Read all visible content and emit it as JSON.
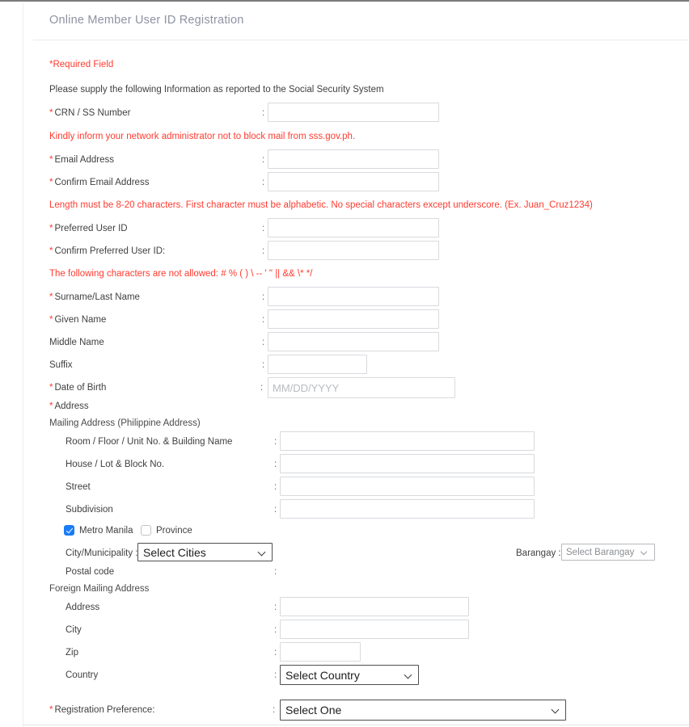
{
  "panel": {
    "title": "Online Member User ID Registration"
  },
  "notices": {
    "required_field": "*Required Field",
    "instruction": "Please supply the following Information as reported to the Social Security System",
    "mail_block": "Kindly inform your network administrator not to block mail from sss.gov.ph.",
    "userid_rule": "Length must be 8-20 characters. First character must be alphabetic. No special characters except underscore. (Ex. Juan_Cruz1234)",
    "disallowed_chars": "The following characters are not allowed: # % ( ) \\ -- ' \" || && \\* */"
  },
  "fields": {
    "crn": {
      "label": "CRN / SS Number",
      "value": "",
      "required": true
    },
    "email": {
      "label": "Email Address",
      "value": "",
      "required": true
    },
    "confirm_email": {
      "label": "Confirm Email Address",
      "value": "",
      "required": true
    },
    "preferred_userid": {
      "label": "Preferred User ID",
      "value": "",
      "required": true
    },
    "confirm_userid": {
      "label": "Confirm Preferred User ID:",
      "value": "",
      "required": true
    },
    "surname": {
      "label": "Surname/Last Name",
      "value": "",
      "required": true
    },
    "given_name": {
      "label": "Given Name",
      "value": "",
      "required": true
    },
    "middle_name": {
      "label": "Middle Name",
      "value": "",
      "required": false
    },
    "suffix": {
      "label": "Suffix",
      "value": "",
      "required": false
    },
    "date_of_birth": {
      "label": "Date of Birth",
      "value": "",
      "placeholder": "MM/DD/YYYY",
      "required": true
    }
  },
  "address": {
    "heading": "Address",
    "mailing_heading": "Mailing Address (Philippine Address)",
    "room": {
      "label": "Room / Floor / Unit No. & Building Name",
      "value": ""
    },
    "house": {
      "label": "House / Lot & Block No.",
      "value": ""
    },
    "street": {
      "label": "Street",
      "value": ""
    },
    "subdivision": {
      "label": "Subdivision",
      "value": ""
    },
    "metro_manila": {
      "label": "Metro Manila",
      "checked": true
    },
    "province": {
      "label": "Province",
      "checked": false
    },
    "city": {
      "label": "City/Municipality :",
      "value": "Select Cities",
      "disabled": false
    },
    "barangay": {
      "label": "Barangay :",
      "value": "Select Barangay",
      "disabled": true
    },
    "postal_code": {
      "label": "Postal code",
      "value": ""
    }
  },
  "foreign": {
    "heading": "Foreign Mailing Address",
    "address": {
      "label": "Address",
      "value": ""
    },
    "city": {
      "label": "City",
      "value": ""
    },
    "zip": {
      "label": "Zip",
      "value": ""
    },
    "country": {
      "label": "Country",
      "value": "Select Country"
    }
  },
  "registration": {
    "label": "Registration Preference:",
    "value": "Select One",
    "required": true
  },
  "colon": ":"
}
